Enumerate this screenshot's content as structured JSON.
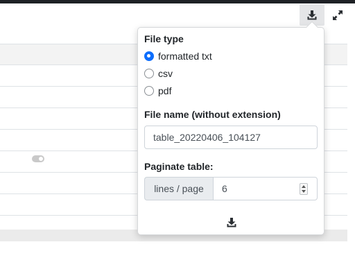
{
  "toolbar": {
    "download_icon": "download-icon",
    "expand_icon": "expand-icon"
  },
  "background_table": {
    "header": "",
    "rows": 8,
    "toggle_icon": "toggle-icon"
  },
  "export_popover": {
    "file_type": {
      "label": "File type",
      "options": [
        {
          "label": "formatted txt",
          "selected": true
        },
        {
          "label": "csv",
          "selected": false
        },
        {
          "label": "pdf",
          "selected": false
        }
      ]
    },
    "file_name": {
      "label": "File name (without extension)",
      "value": "table_20220406_104127"
    },
    "paginate": {
      "label": "Paginate table:",
      "addon": "lines / page",
      "value": "6"
    },
    "submit_icon": "download-icon"
  },
  "colors": {
    "accent": "#0d6efd",
    "topbar": "#1e2125",
    "button_bg": "#e4e5e7"
  }
}
